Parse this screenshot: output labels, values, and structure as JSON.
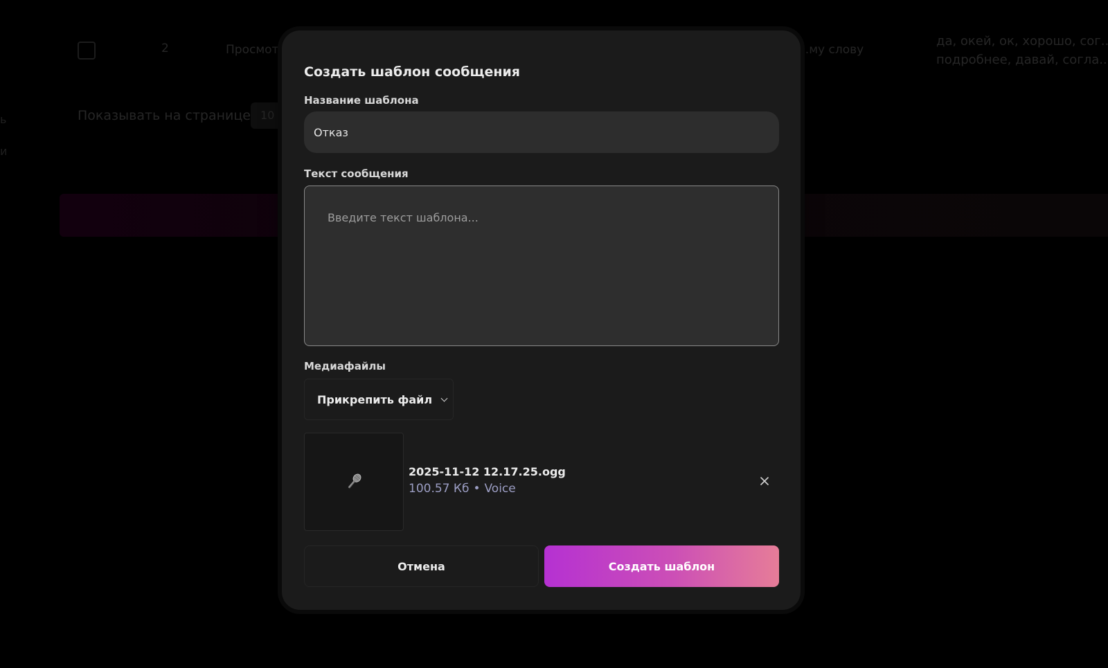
{
  "background": {
    "counter": "2",
    "view_label": "Просмотр",
    "word_label": "...му слову",
    "keywords": [
      "да, окей, ок, хорошо, сог...",
      "подробнее, давай, согла..."
    ],
    "per_page_label": "Показывать на странице",
    "per_page_value": "10",
    "edge_letters": [
      "ь",
      "и"
    ]
  },
  "modal": {
    "title": "Создать шаблон сообщения",
    "name_label": "Название шаблона",
    "name_value": "Отказ",
    "text_label": "Текст сообщения",
    "text_placeholder": "Введите текст шаблона...",
    "media_label": "Медиафайлы",
    "attach_label": "Прикрепить файл",
    "file": {
      "icon": "microphone-icon",
      "name": "2025-11-12 12.17.25.ogg",
      "size": "100.57 Кб",
      "separator": "•",
      "type": "Voice"
    },
    "cancel_label": "Отмена",
    "create_label": "Создать шаблон"
  },
  "colors": {
    "modal_bg": "#1b1b1b",
    "input_bg": "#2d2d2d",
    "accent_start": "#b531d2",
    "accent_end": "#e67d98",
    "meta_text": "#9c9ec4"
  }
}
